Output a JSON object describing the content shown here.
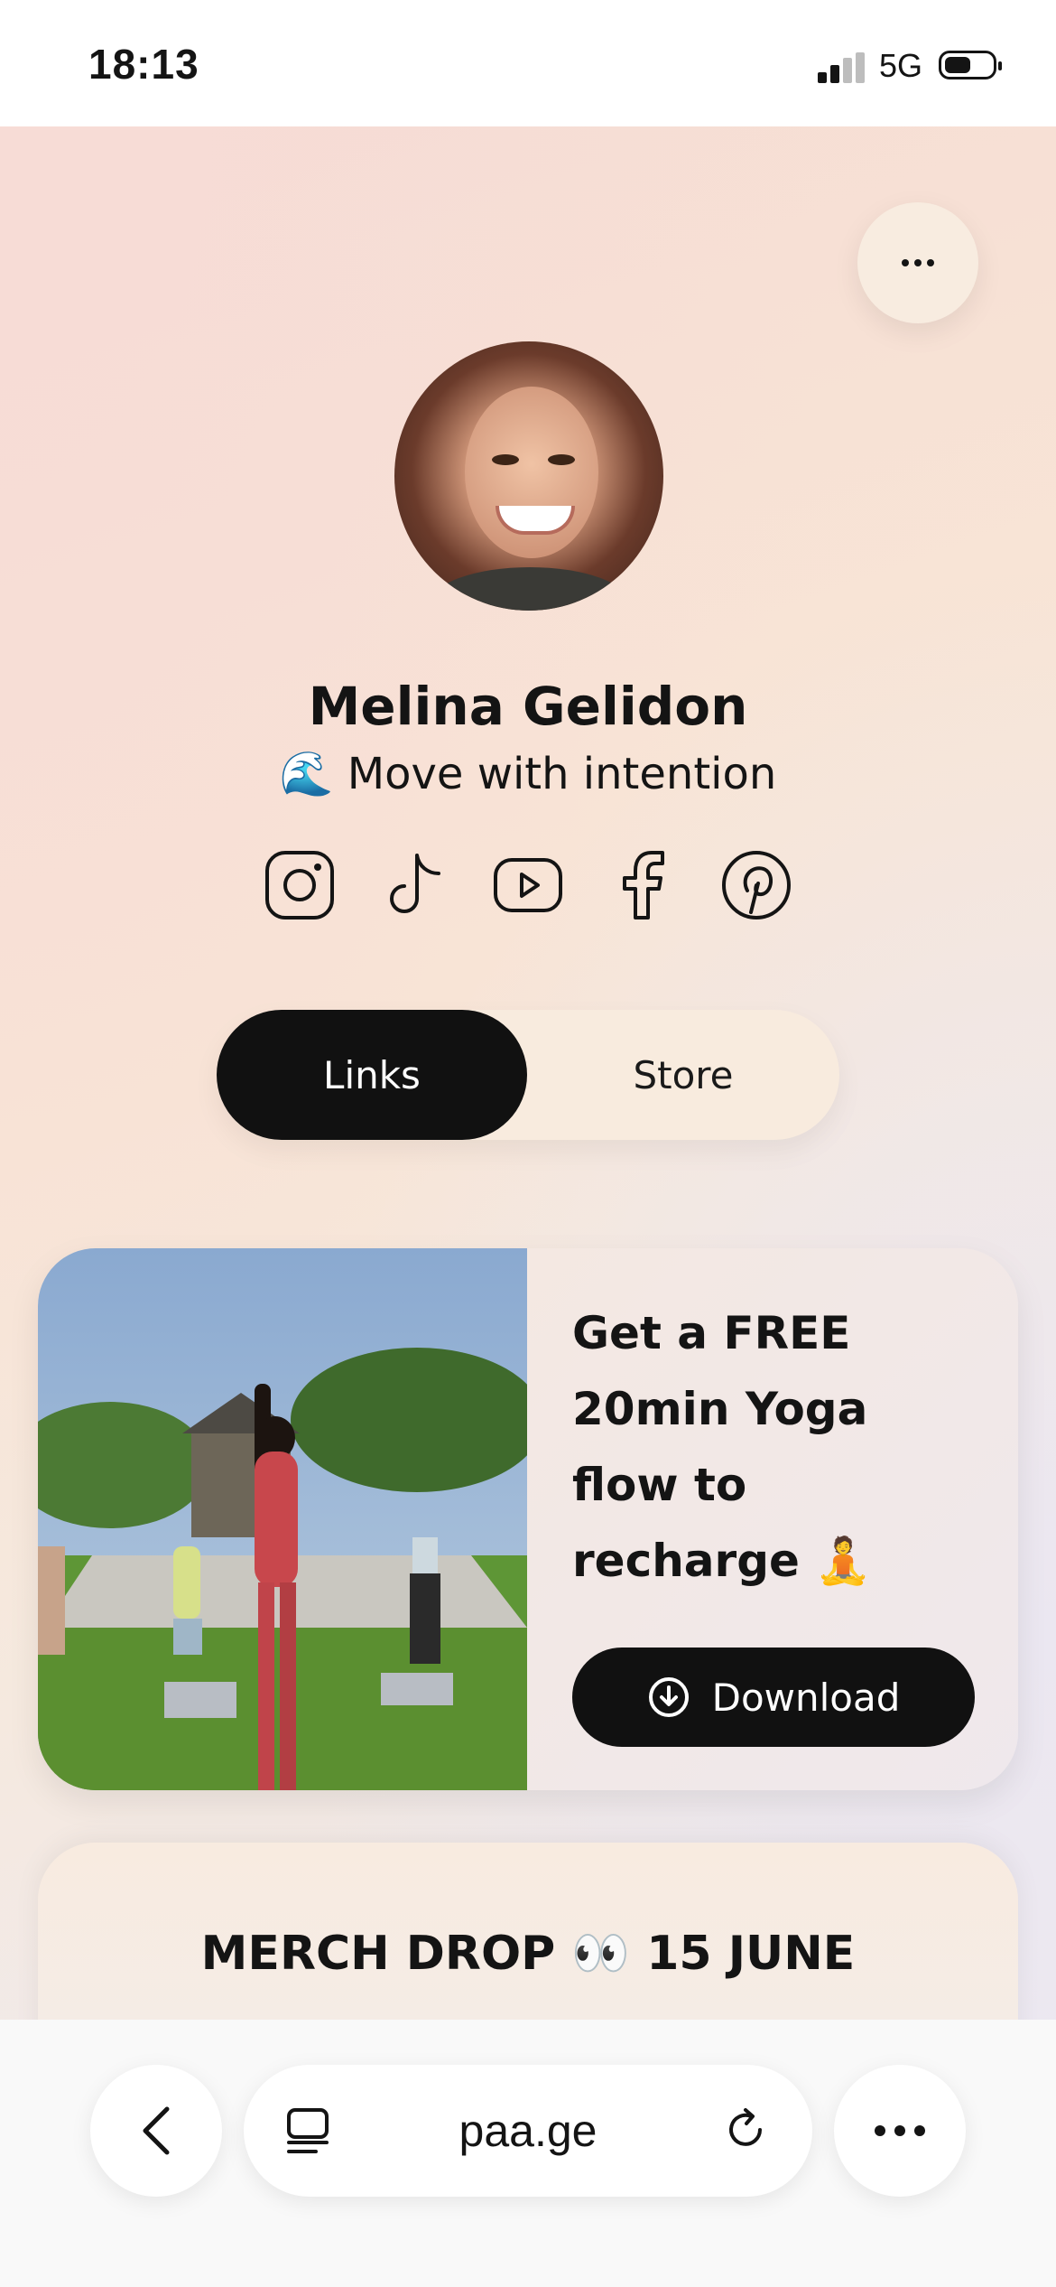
{
  "status_bar": {
    "time": "18:13",
    "network": "5G"
  },
  "profile": {
    "name": "Melina Gelidon",
    "tagline": "🌊 Move with intention"
  },
  "socials": [
    "instagram-icon",
    "tiktok-icon",
    "youtube-icon",
    "facebook-icon",
    "pinterest-icon"
  ],
  "tabs": {
    "links": "Links",
    "store": "Store",
    "active": "Links"
  },
  "cards": [
    {
      "title": "Get a FREE 20min Yoga flow to recharge 🧘",
      "button": "Download"
    },
    {
      "title": "MERCH DROP 👀 15 JUNE"
    }
  ],
  "browser": {
    "url": "paa.ge"
  }
}
